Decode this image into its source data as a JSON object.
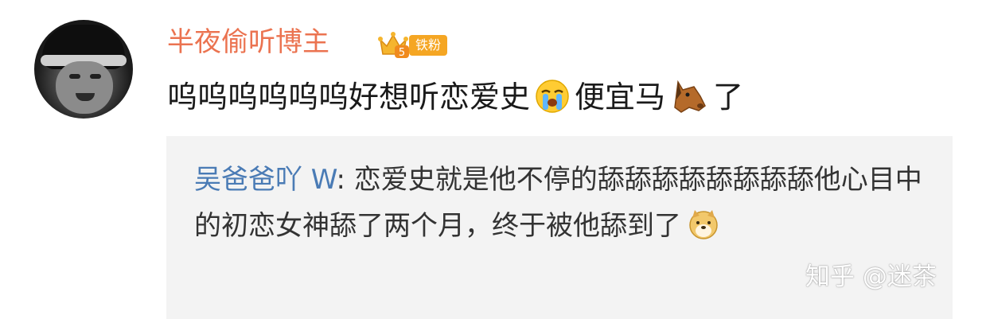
{
  "comment": {
    "username": "半夜偷听博主",
    "fan_badge": {
      "level": "5",
      "label": "铁粉",
      "crown_icon": "crown-icon",
      "color": "#f5a623"
    },
    "text_part1": "呜呜呜呜呜呜好想听恋爱史",
    "emoji1": "crying-face-emoji",
    "text_part2": "便宜马",
    "emoji2": "horse-face-emoji",
    "text_part3": "了",
    "username_color": "#eb7350"
  },
  "reply": {
    "author": "吴爸爸吖 W",
    "separator": ": ",
    "text": "恋爱史就是他不停的舔舔舔舔舔舔舔舔他心目中的初恋女神舔了两个月，终于被他舔到了",
    "emoji": "doge-emoji",
    "author_color": "#4a7bb5"
  },
  "watermark": "知乎 @迷茶"
}
